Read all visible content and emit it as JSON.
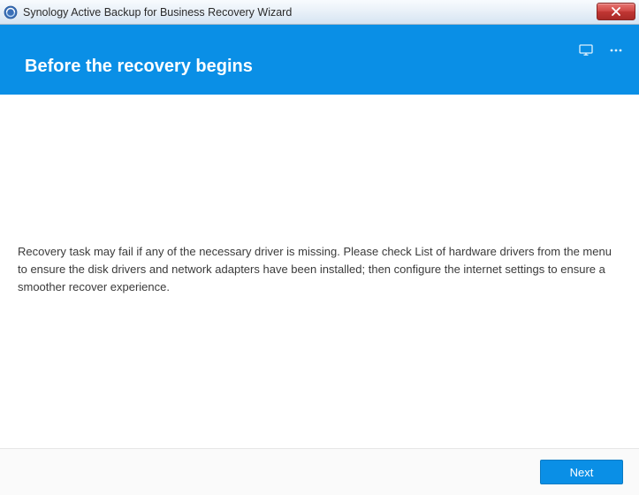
{
  "titlebar": {
    "title": "Synology Active Backup for Business Recovery Wizard"
  },
  "banner": {
    "heading": "Before the recovery begins"
  },
  "content": {
    "message": "Recovery task may fail if any of the necessary driver is missing. Please check List of hardware drivers from the menu to ensure the disk drivers and network adapters have been installed; then configure the internet settings to ensure a smoother recover experience."
  },
  "footer": {
    "next_label": "Next"
  },
  "icons": {
    "monitor": "monitor-icon",
    "menu": "more-menu-icon",
    "close": "close-icon",
    "app": "app-icon"
  }
}
